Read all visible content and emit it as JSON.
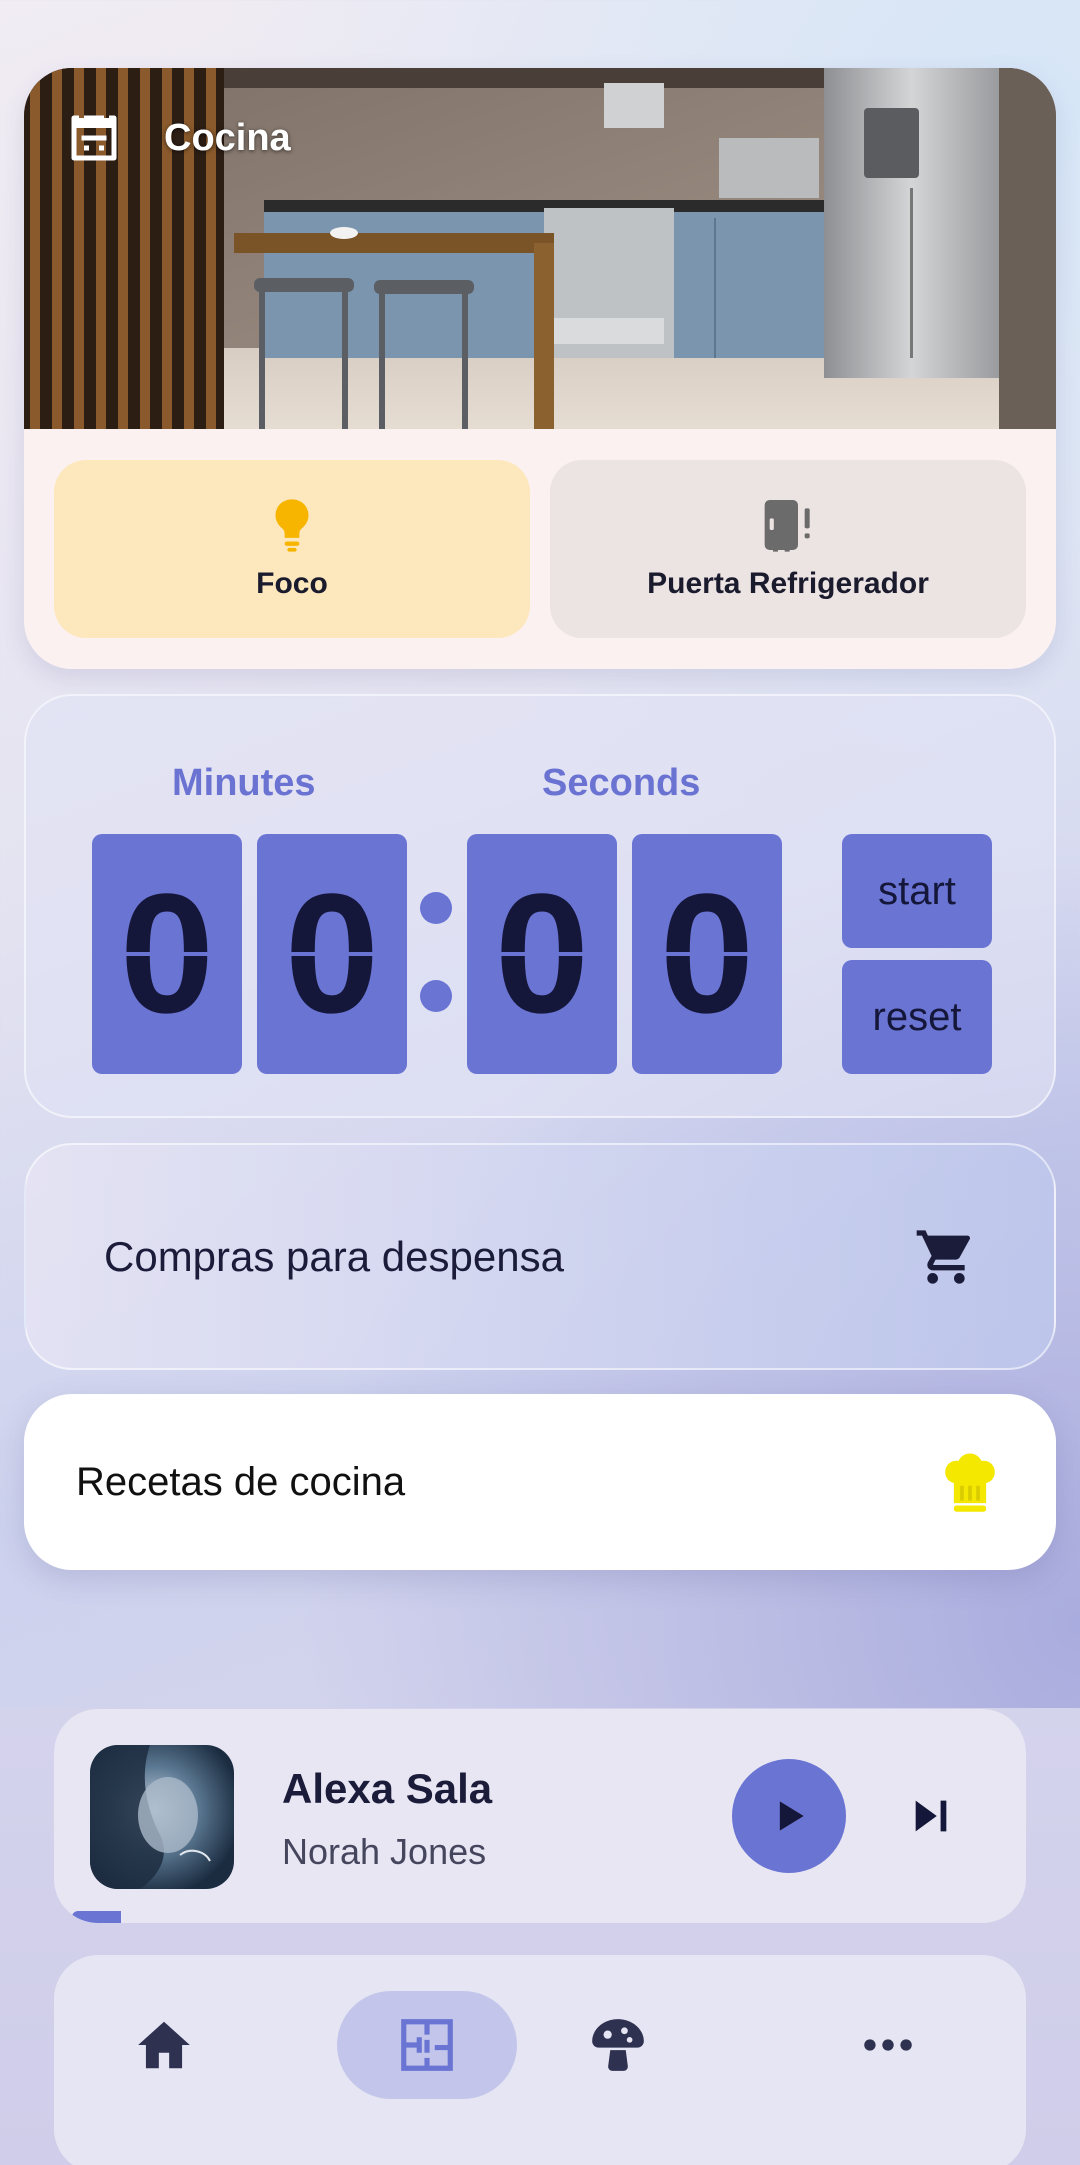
{
  "room": {
    "title": "Cocina",
    "icon": "oven-icon",
    "photo": "kitchen-photo"
  },
  "devices": [
    {
      "label": "Foco",
      "icon": "lightbulb-icon",
      "state": "on",
      "color": "#fde7bd",
      "icon_color": "#f7b500"
    },
    {
      "label": "Puerta Refrigerador",
      "icon": "fridge-alert-icon",
      "state": "off",
      "color": "#ece3e3",
      "icon_color": "#6b6b6b"
    }
  ],
  "timer": {
    "minutes_label": "Minutes",
    "seconds_label": "Seconds",
    "digits": [
      "0",
      "0",
      "0",
      "0"
    ],
    "start_label": "start",
    "reset_label": "reset",
    "accent": "#6a74d3"
  },
  "shopping": {
    "label": "Compras para despensa",
    "icon": "cart-icon"
  },
  "recipes": {
    "label": "Recetas de cocina",
    "icon": "chef-hat-icon",
    "icon_color": "#f5e800"
  },
  "player": {
    "title": "Alexa Sala",
    "artist": "Norah Jones",
    "progress": 0.05
  },
  "nav": {
    "items": [
      {
        "icon": "home-icon",
        "active": false
      },
      {
        "icon": "floorplan-icon",
        "active": true
      },
      {
        "icon": "mushroom-icon",
        "active": false
      },
      {
        "icon": "more-icon",
        "active": false
      }
    ]
  }
}
